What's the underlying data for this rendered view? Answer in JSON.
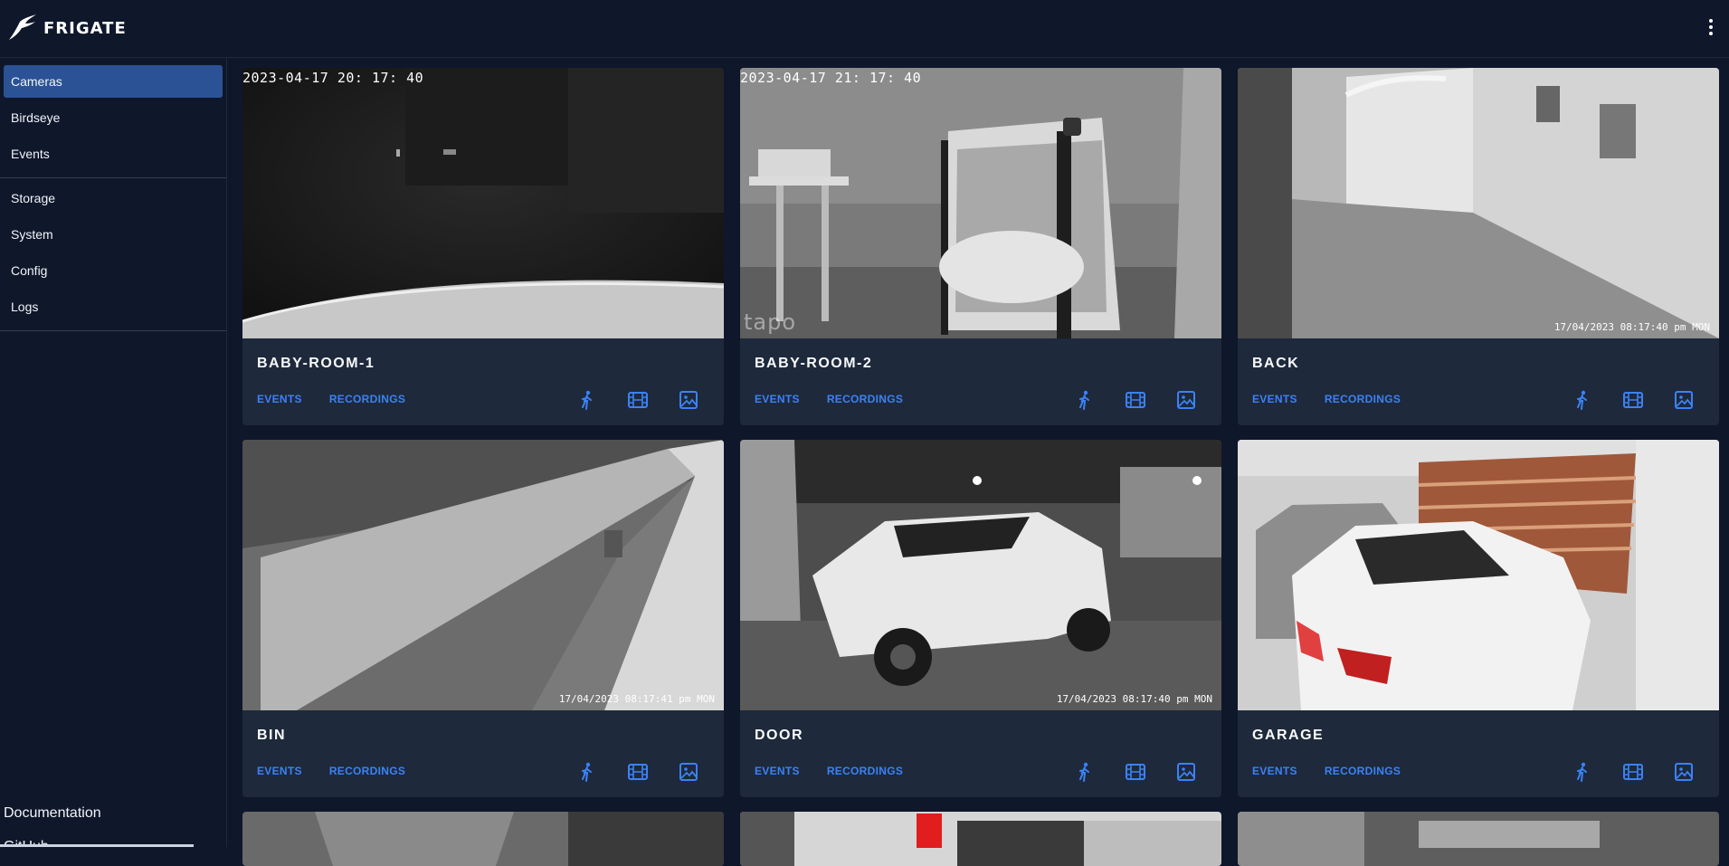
{
  "app": {
    "name": "FRIGATE"
  },
  "sidebar": {
    "items": [
      {
        "label": "Cameras",
        "active": true
      },
      {
        "label": "Birdseye"
      },
      {
        "label": "Events"
      },
      {
        "label": "Storage"
      },
      {
        "label": "System"
      },
      {
        "label": "Config"
      },
      {
        "label": "Logs"
      }
    ],
    "footer": {
      "documentation": "Documentation",
      "github": "GitHub"
    }
  },
  "card_actions": {
    "events": "EVENTS",
    "recordings": "RECORDINGS"
  },
  "icons": {
    "detect": "person-walking-icon",
    "recordings": "film-icon",
    "snapshots": "image-icon",
    "menu": "kebab-menu-icon"
  },
  "colors": {
    "accent": "#3b82f6",
    "active_nav": "#2b5294",
    "card": "#1e293b",
    "background": "#0f172a"
  },
  "cameras": [
    {
      "name": "BABY-ROOM-1",
      "timestamp": "2023-04-17  20: 17: 40"
    },
    {
      "name": "BABY-ROOM-2",
      "timestamp": "2023-04-17  21: 17: 40",
      "watermark": "tapo"
    },
    {
      "name": "BACK",
      "overlay": "17/04/2023 08:17:40 pm MON"
    },
    {
      "name": "BIN",
      "overlay": "17/04/2023 08:17:41 pm MON"
    },
    {
      "name": "DOOR",
      "overlay": "17/04/2023 08:17:40 pm MON"
    },
    {
      "name": "GARAGE"
    }
  ]
}
